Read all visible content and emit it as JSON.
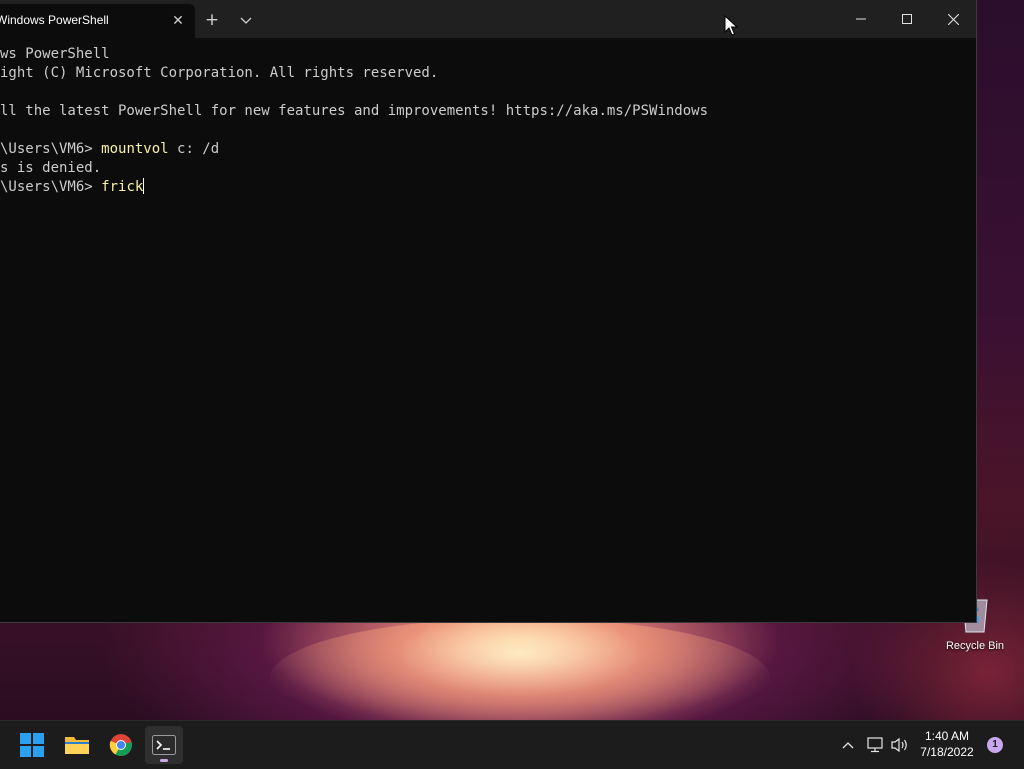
{
  "window": {
    "tab_title": "Windows PowerShell",
    "tab_close": "✕",
    "new_tab": "+",
    "dropdown": "⌄"
  },
  "console": {
    "lines": [
      {
        "text": "ws PowerShell"
      },
      {
        "text": "ight (C) Microsoft Corporation. All rights reserved."
      },
      {
        "text": ""
      },
      {
        "text": "ll the latest PowerShell for new features and improvements! https://aka.ms/PSWindows"
      },
      {
        "text": ""
      },
      {
        "prompt": "\\Users\\VM6> ",
        "cmd": "mountvol",
        "rest": " c: /d"
      },
      {
        "text": "s is denied."
      },
      {
        "prompt": "\\Users\\VM6> ",
        "cmd": "frick",
        "rest": ""
      }
    ]
  },
  "desktop": {
    "recycle_bin_label": "Recycle Bin"
  },
  "taskbar": {
    "apps": [
      "start-icon",
      "file-explorer-icon",
      "chrome-icon",
      "terminal-icon"
    ],
    "clock_time": "1:40 AM",
    "clock_date": "7/18/2022",
    "notification_count": "1"
  }
}
